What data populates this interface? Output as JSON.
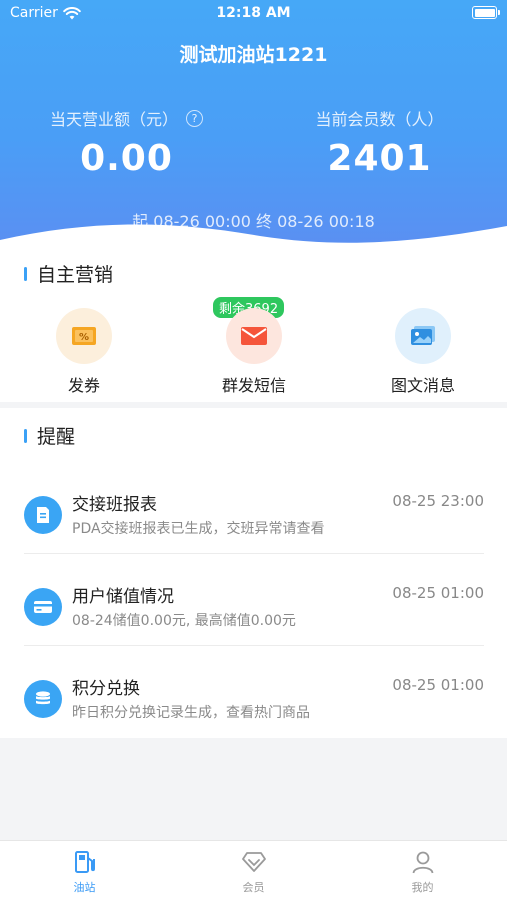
{
  "status_bar": {
    "carrier": "Carrier",
    "time": "12:18 AM"
  },
  "header": {
    "station_name": "测试加油站1221",
    "revenue_label": "当天营业额（元）",
    "revenue_value": "0.00",
    "members_label": "当前会员数（人）",
    "members_value": "2401",
    "time_range": "起 08-26 00:00 终 08-26 00:18"
  },
  "marketing": {
    "title": "自主营销",
    "sms_badge": "剩余3692",
    "items": [
      {
        "label": "发券",
        "icon": "coupon-icon",
        "color": "#fcefdc"
      },
      {
        "label": "群发短信",
        "icon": "envelope-icon",
        "color": "#fde6de"
      },
      {
        "label": "图文消息",
        "icon": "image-message-icon",
        "color": "#e0f0fc"
      }
    ]
  },
  "reminders": {
    "title": "提醒",
    "items": [
      {
        "title": "交接班报表",
        "time": "08-25 23:00",
        "desc": "PDA交接班报表已生成，交班异常请查看",
        "icon": "report-icon"
      },
      {
        "title": "用户储值情况",
        "time": "08-25 01:00",
        "desc": "08-24储值0.00元, 最高储值0.00元",
        "icon": "card-icon"
      },
      {
        "title": "积分兑换",
        "time": "08-25 01:00",
        "desc": "昨日积分兑换记录生成，查看热门商品",
        "icon": "coins-icon"
      }
    ]
  },
  "tabbar": {
    "items": [
      {
        "label": "油站",
        "icon": "fuel-station-icon",
        "active": true
      },
      {
        "label": "会员",
        "icon": "member-diamond-icon",
        "active": false
      },
      {
        "label": "我的",
        "icon": "profile-icon",
        "active": false
      }
    ]
  },
  "colors": {
    "accent": "#3a9af5",
    "header_top": "#46a8f7",
    "badge": "#2ec75e"
  }
}
